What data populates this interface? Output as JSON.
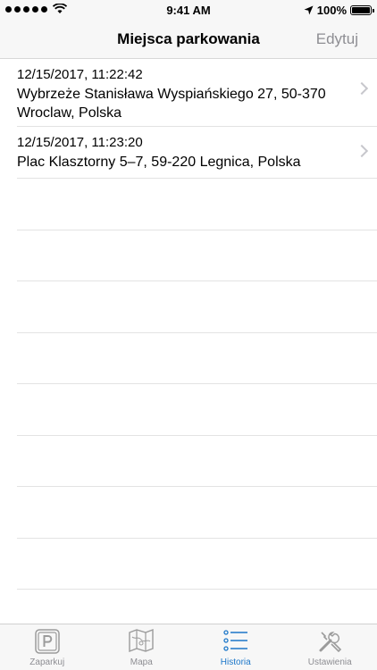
{
  "status_bar": {
    "time": "9:41 AM",
    "battery": "100%"
  },
  "nav": {
    "title": "Miejsca parkowania",
    "edit_label": "Edytuj"
  },
  "history": [
    {
      "date": "12/15/2017, 11:22:42",
      "address": "Wybrzeże Stanisława Wyspiańskiego 27, 50-370 Wroclaw, Polska"
    },
    {
      "date": "12/15/2017, 11:23:20",
      "address": "Plac Klasztorny 5–7, 59-220 Legnica, Polska"
    }
  ],
  "tabs": [
    {
      "label": "Zaparkuj",
      "icon": "parking-icon",
      "active": false
    },
    {
      "label": "Mapa",
      "icon": "map-icon",
      "active": false
    },
    {
      "label": "Historia",
      "icon": "list-icon",
      "active": true
    },
    {
      "label": "Ustawienia",
      "icon": "tools-icon",
      "active": false
    }
  ],
  "colors": {
    "accent": "#1d77c9",
    "inactive": "#8e8e93",
    "separator": "#e3e3e3",
    "bar_bg": "#f7f7f7"
  }
}
